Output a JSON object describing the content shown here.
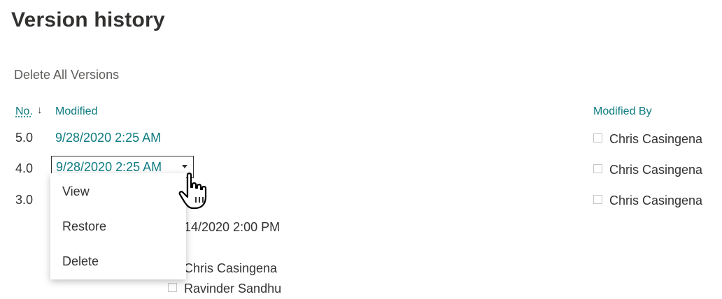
{
  "page": {
    "title": "Version history",
    "delete_all": "Delete All Versions"
  },
  "columns": {
    "no": "No.",
    "modified": "Modified",
    "modified_by": "Modified By"
  },
  "rows": [
    {
      "version": "5.0",
      "modified": "9/28/2020 2:25 AM",
      "modified_by": "Chris Casingena"
    },
    {
      "version": "4.0",
      "modified": "9/28/2020 2:25 AM",
      "modified_by": "Chris Casingena"
    },
    {
      "version": "3.0",
      "modified_by": "Chris Casingena"
    }
  ],
  "context_menu": {
    "items": [
      "View",
      "Restore",
      "Delete"
    ]
  },
  "background_fragments": {
    "date_partial": "/14/2020 2:00 PM",
    "user_1": "Chris Casingena",
    "user_2": "Ravinder Sandhu"
  },
  "icons": {
    "sort": "arrow-down-icon",
    "dropdown": "caret-down-icon",
    "pointer": "hand-pointer-icon"
  },
  "colors": {
    "link": "#0f7c82",
    "text": "#333333"
  }
}
